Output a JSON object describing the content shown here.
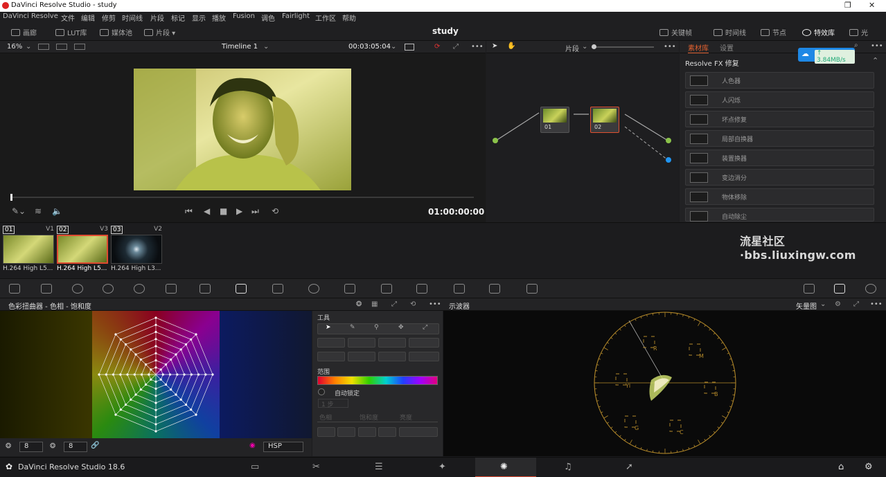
{
  "window": {
    "title": "DaVinci Resolve Studio - study"
  },
  "menu": [
    "DaVinci Resolve",
    "文件",
    "编辑",
    "修剪",
    "时间线",
    "片段",
    "标记",
    "显示",
    "播放",
    "Fusion",
    "调色",
    "Fairlight",
    "工作区",
    "帮助"
  ],
  "toolbar": {
    "left": [
      "画廊",
      "LUT库",
      "媒体池",
      "片段"
    ],
    "project": "study",
    "right": [
      "关键帧",
      "时间线",
      "节点",
      "特效库",
      "光"
    ]
  },
  "viewer": {
    "zoom": "16%",
    "timeline_name": "Timeline 1",
    "timecode_top": "00:03:05:04",
    "timecode": "01:00:00:00",
    "playhead_fraction": 0.0
  },
  "node_editor": {
    "mode_label": "片段",
    "nodes": [
      {
        "label": "01"
      },
      {
        "label": "02"
      }
    ]
  },
  "library": {
    "tabs": [
      "素材库",
      "设置"
    ],
    "section": "Resolve FX 修复",
    "items": [
      "人色器",
      "人闪烁",
      "坏点修复",
      "局部自换器",
      "装置换器",
      "变边消分",
      "物体移除",
      "自动除尘"
    ]
  },
  "speed_badge": {
    "text": "3.84MB/s"
  },
  "clips": [
    {
      "num": "01",
      "track": "V1",
      "name": "H.264 High L5..."
    },
    {
      "num": "02",
      "track": "V3",
      "name": "H.264 High L5..."
    },
    {
      "num": "03",
      "track": "V2",
      "name": "H.264 High L3..."
    }
  ],
  "watermark": "流星社区·bbs.liuxingw.com",
  "lower": {
    "qualifier_title": "色彩扭曲器 - 色相 - 饱和度",
    "scope_title": "示波器",
    "scope_mode": "矢量图",
    "tools_title": "工具",
    "range_label": "范围",
    "auto_lock": "自动锁定",
    "wheel_foot": {
      "a": "8",
      "b": "8",
      "mode": "HSP"
    },
    "tool_sub": [
      "色相",
      "饱和度",
      "亮度"
    ],
    "dropdown": "1 步"
  },
  "vectorscope_targets": [
    "R",
    "M",
    "B",
    "C",
    "G",
    "Yl"
  ],
  "footer": {
    "brand": "DaVinci Resolve Studio 18.6"
  }
}
